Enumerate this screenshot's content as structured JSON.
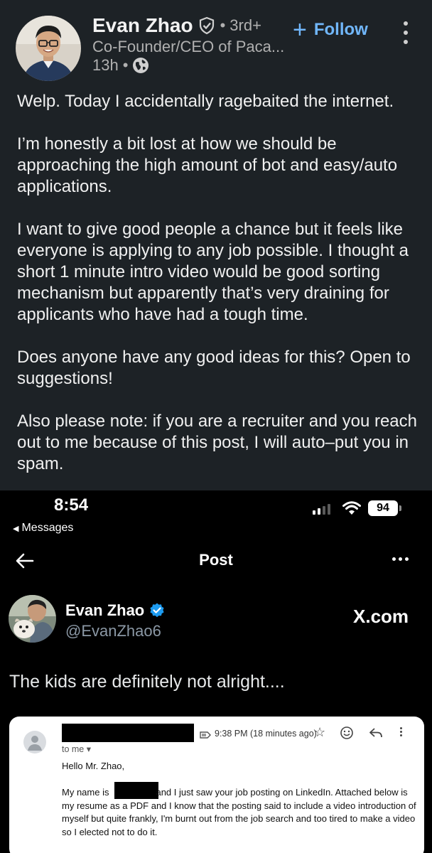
{
  "linkedin": {
    "name": "Evan Zhao",
    "degree": "3rd+",
    "degree_prefix": "•",
    "headline": "Co-Founder/CEO of Paca...",
    "time": "13h",
    "time_sep": "•",
    "follow_label": "Follow",
    "follow_plus": "+",
    "icons": {
      "verified": "shield-check-icon",
      "visibility": "globe-icon",
      "more": "kebab-icon"
    },
    "accent_color": "#71b7fb",
    "background": "#1d2226",
    "paragraphs": [
      "Welp. Today I accidentally ragebaited the internet.",
      "I’m honestly a bit lost at how we should be approaching the high amount of bot and easy/auto applications.",
      "I want to give good people a chance but it feels like everyone is applying to any job possible. I thought a short 1 minute intro video would be good sorting mechanism but apparently that’s very draining for applicants who have had a tough time.",
      "Does anyone have any good ideas for this? Open to suggestions!",
      "Also please note: if you are a recruiter and you reach out to me because of this post, I will auto–put you in spam."
    ]
  },
  "status_bar": {
    "time": "8:54",
    "back_label": "Messages",
    "back_glyph": "◀",
    "battery": "94"
  },
  "x_post": {
    "header_title": "Post",
    "name": "Evan Zhao",
    "handle": "@EvanZhao6",
    "watermark": "X.com",
    "text": "The kids are definitely not alright....",
    "verified_color": "#1d9bf0"
  },
  "email": {
    "time": "9:38 PM (18 minutes ago)",
    "to_label": "to me ▾",
    "greeting": "Hello Mr. Zhao,",
    "body_line1_a": "My name is",
    "body_line1_b": "and I just saw your job posting on LinkedIn. Attached below is my",
    "body_rest": "resume as a PDF and I know that the posting said to include a video introduction of myself but quite frankly, I'm burnt out from the job search and too tired to make a video so I elected not to do it."
  }
}
